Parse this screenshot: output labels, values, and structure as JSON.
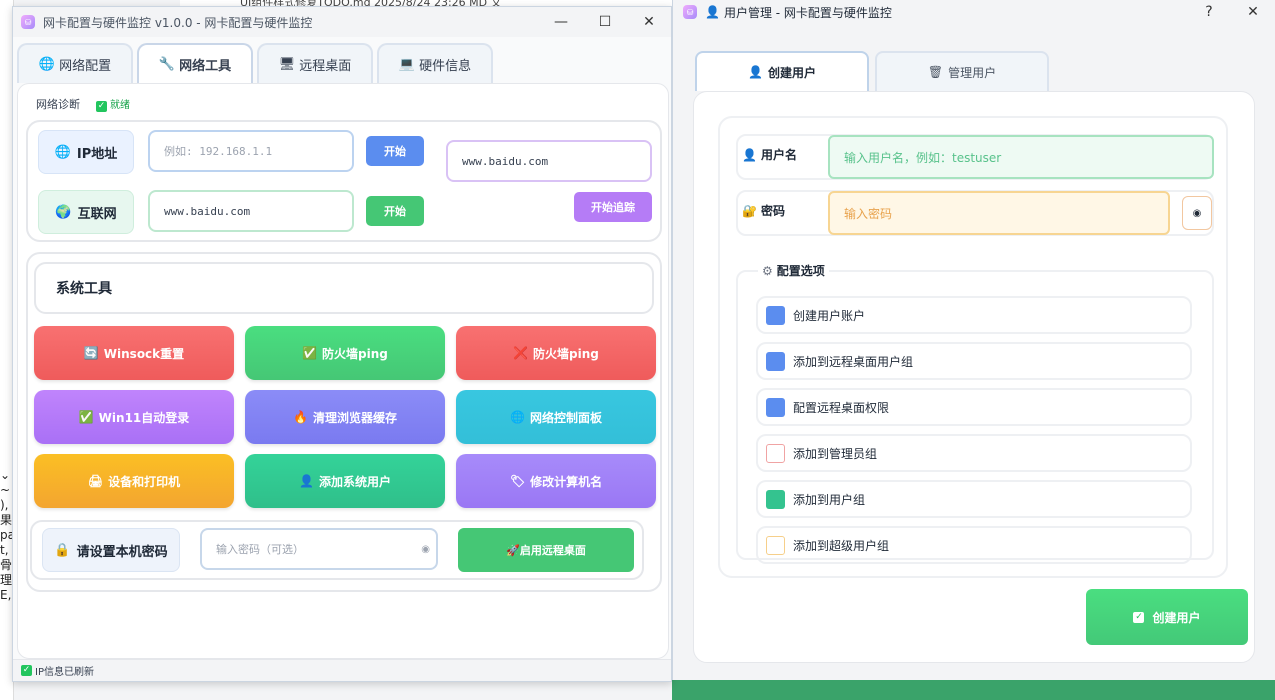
{
  "background": {
    "editor_lines": [
      "⌄",
      "~",
      "),",
      "果(",
      "pa",
      "t,",
      "骨复",
      "理",
      "E,"
    ],
    "top_text": "UI组件样式修复TODO.md   2025/8/24 23:26   MD 文"
  },
  "main_window": {
    "title": "网卡配置与硬件监控 v1.0.0 - 网卡配置与硬件监控",
    "tabs": [
      {
        "icon": "🌐",
        "label": "网络配置"
      },
      {
        "icon": "🔧",
        "label": "网络工具"
      },
      {
        "icon": "🖥",
        "label": "远程桌面"
      },
      {
        "icon": "💻",
        "label": "硬件信息"
      }
    ],
    "diag_label": "网络诊断",
    "diag_status": "就绪",
    "ip": {
      "icon": "🌐",
      "label": "IP地址",
      "placeholder": "例如: 192.168.1.1",
      "button": "开始"
    },
    "internet": {
      "icon": "🌍",
      "label": "互联网",
      "value": "www.baidu.com",
      "button": "开始"
    },
    "trace": {
      "value": "www.baidu.com",
      "button": "开始追踪"
    },
    "tools_title": "系统工具",
    "tools": [
      {
        "icon": "🔄",
        "label": "Winsock重置",
        "color": "red"
      },
      {
        "icon": "✅",
        "label": "防火墙ping",
        "color": "green"
      },
      {
        "icon": "❌",
        "label": "防火墙ping",
        "color": "red"
      },
      {
        "icon": "✅",
        "label": "Win11自动登录",
        "color": "purple"
      },
      {
        "icon": "🔥",
        "label": "清理浏览器缓存",
        "color": "indigo"
      },
      {
        "icon": "🌐",
        "label": "网络控制面板",
        "color": "cyan"
      },
      {
        "icon": "🖨",
        "label": "设备和打印机",
        "color": "orange"
      },
      {
        "icon": "👤",
        "label": "添加系统用户",
        "color": "teal"
      },
      {
        "icon": "🏷",
        "label": "修改计算机名",
        "color": "violet"
      }
    ],
    "password": {
      "icon": "🔒",
      "label": "请设置本机密码",
      "placeholder": "输入密码（可选）",
      "button": "启用远程桌面",
      "button_icon": "🚀"
    },
    "status": "IP信息已刷新"
  },
  "user_window": {
    "title": "用户管理 - 网卡配置与硬件监控",
    "help": "?",
    "tabs": [
      {
        "icon": "👤",
        "label": "创建用户"
      },
      {
        "icon": "🗑",
        "label": "管理用户"
      }
    ],
    "username": {
      "icon": "👤",
      "label": "用户名",
      "placeholder": "输入用户名，例如：testuser"
    },
    "password": {
      "icon": "🔐",
      "label": "密码",
      "placeholder": "输入密码"
    },
    "config_title": "配置选项",
    "options": [
      {
        "label": "创建用户账户",
        "state": "blue"
      },
      {
        "label": "添加到远程桌面用户组",
        "state": "blue"
      },
      {
        "label": "配置远程桌面权限",
        "state": "blue"
      },
      {
        "label": "添加到管理员组",
        "state": "red"
      },
      {
        "label": "添加到用户组",
        "state": "green"
      },
      {
        "label": "添加到超级用户组",
        "state": "amber"
      }
    ],
    "create_button": "创建用户"
  }
}
